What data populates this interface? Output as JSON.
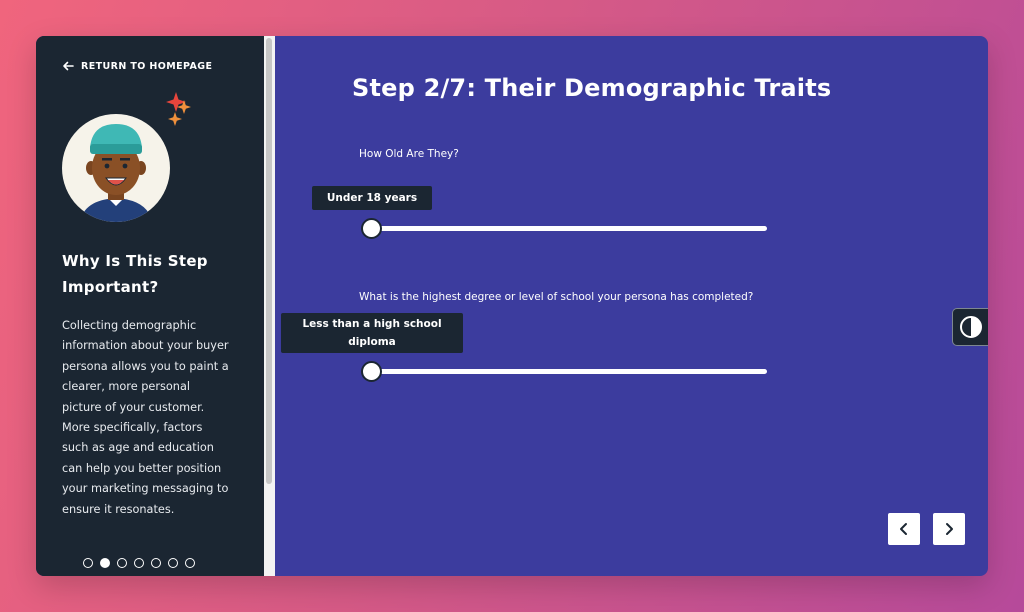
{
  "sidebar": {
    "return_label": "RETURN TO HOMEPAGE",
    "why_title": "Why Is This Step Important?",
    "why_body": "Collecting demographic information about your buyer persona allows you to paint a clearer, more personal picture of your customer. More specifically, factors such as age and education can help you better position your marketing messaging to ensure it resonates.",
    "pagination": {
      "total": 7,
      "active_index": 1
    }
  },
  "main": {
    "title": "Step 2/7: Their Demographic Traits",
    "questions": [
      {
        "label": "How Old Are They?",
        "value_label": "Under 18 years",
        "value_fraction": 0
      },
      {
        "label": "What is the highest degree or level of school your persona has completed?",
        "value_label": "Less than a high school diploma",
        "value_fraction": 0
      }
    ]
  },
  "colors": {
    "background_gradient": [
      "#f0657d",
      "#b64a9a"
    ],
    "main_panel": "#3c3c9e",
    "sidebar": "#1b2632",
    "sparkle_red": "#e8453c",
    "sparkle_orange": "#f0903c",
    "hat": "#3fb8b5"
  },
  "icons": {
    "return": "arrow-left-icon",
    "contrast": "contrast-icon",
    "prev": "chevron-left-icon",
    "next": "chevron-right-icon"
  }
}
